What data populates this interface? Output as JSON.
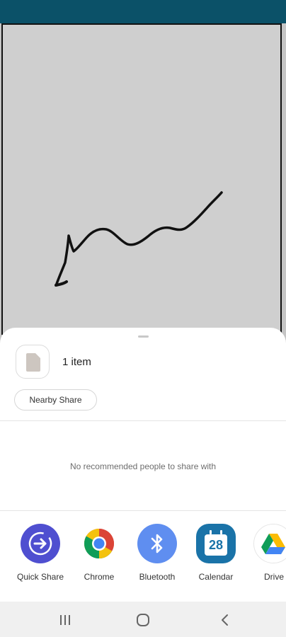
{
  "canvas": {
    "stroke_color": "#111111",
    "background": "#cfcfcf"
  },
  "share_sheet": {
    "item_count": "1 item",
    "nearby_share_label": "Nearby Share",
    "no_recommendations": "No recommended people to share with",
    "apps": [
      {
        "label": "Quick Share",
        "icon": "quick-share-icon"
      },
      {
        "label": "Chrome",
        "icon": "chrome-icon"
      },
      {
        "label": "Bluetooth",
        "icon": "bluetooth-icon"
      },
      {
        "label": "Calendar",
        "icon": "calendar-icon",
        "icon_text": "28"
      },
      {
        "label": "Drive",
        "icon": "drive-icon"
      }
    ]
  },
  "colors": {
    "status_bar": "#0b5168",
    "quick_share": "#4f4fd0",
    "bluetooth": "#5f8ef0",
    "calendar": "#1a73a8"
  },
  "navigation": {
    "recents": "recents-icon",
    "home": "home-icon",
    "back": "back-icon"
  }
}
